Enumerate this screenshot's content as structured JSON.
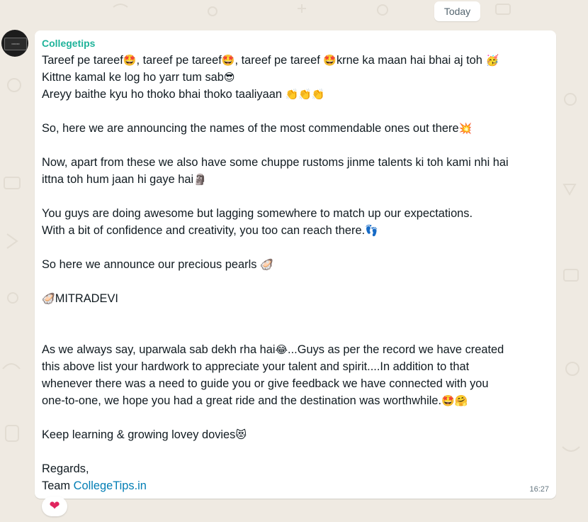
{
  "date_divider": "Today",
  "message": {
    "sender": "Collegetips",
    "time": "16:27",
    "lines": [
      {
        "parts": [
          {
            "t": "Tareef pe tareef"
          },
          {
            "t": "🤩",
            "e": 1
          },
          {
            "t": ", tareef pe tareef"
          },
          {
            "t": "🤩",
            "e": 1
          },
          {
            "t": ", tareef pe tareef "
          },
          {
            "t": "🤩",
            "e": 1
          },
          {
            "t": "krne ka maan hai bhai aj toh "
          },
          {
            "t": "🥳",
            "e": 1
          }
        ]
      },
      {
        "parts": [
          {
            "t": "Kittne kamal ke log ho yarr tum sab"
          },
          {
            "t": "😎",
            "e": 1
          }
        ]
      },
      {
        "parts": [
          {
            "t": "Areyy baithe kyu ho thoko bhai thoko taaliyaan "
          },
          {
            "t": "👏👏👏",
            "e": 1
          }
        ]
      },
      {
        "blank": true
      },
      {
        "parts": [
          {
            "t": "So, here we are announcing the names of the most commendable ones out there"
          },
          {
            "t": "💥",
            "e": 1
          }
        ]
      },
      {
        "blank": true
      },
      {
        "parts": [
          {
            "t": "Now, apart from these we also have some chuppe rustoms jinme talents ki toh kami nhi hai"
          }
        ]
      },
      {
        "parts": [
          {
            "t": "ittna toh hum jaan hi gaye hai"
          },
          {
            "t": "🗿",
            "e": 1
          }
        ]
      },
      {
        "blank": true
      },
      {
        "parts": [
          {
            "t": "You guys are doing awesome but lagging somewhere to match up our expectations."
          }
        ]
      },
      {
        "parts": [
          {
            "t": "With a bit of confidence and creativity, you too can reach there."
          },
          {
            "t": "👣",
            "e": 1
          }
        ]
      },
      {
        "blank": true
      },
      {
        "parts": [
          {
            "t": "So here we announce our precious pearls "
          },
          {
            "t": "🦪",
            "e": 1
          }
        ]
      },
      {
        "blank": true
      },
      {
        "parts": [
          {
            "t": "🦪",
            "e": 1
          },
          {
            "t": "MITRADEVI"
          }
        ]
      },
      {
        "blank": true
      },
      {
        "blank": true
      },
      {
        "parts": [
          {
            "t": "As we always say, uparwala sab dekh rha hai"
          },
          {
            "t": "😂",
            "e": 1
          },
          {
            "t": "...Guys as per the record we have created"
          }
        ]
      },
      {
        "parts": [
          {
            "t": "this above list your hardwork to appreciate your talent and spirit....In addition to that"
          }
        ]
      },
      {
        "parts": [
          {
            "t": "whenever there was a need to guide you or give feedback we have connected with you"
          }
        ]
      },
      {
        "parts": [
          {
            "t": "one-to-one, we hope you had a great ride and the destination was worthwhile."
          },
          {
            "t": "🤩🤗",
            "e": 1
          }
        ]
      },
      {
        "blank": true
      },
      {
        "parts": [
          {
            "t": "Keep learning & growing lovey dovies"
          },
          {
            "t": "😻",
            "e": 1
          }
        ]
      },
      {
        "blank": true
      },
      {
        "parts": [
          {
            "t": "Regards,"
          }
        ]
      },
      {
        "parts": [
          {
            "t": "Team "
          },
          {
            "t": "CollegeTips.in",
            "link": 1
          }
        ]
      }
    ]
  },
  "reaction": "❤",
  "colors": {
    "background": "#efeae2",
    "bubble": "#ffffff",
    "sender": "#1fb39a",
    "link": "#027eb5",
    "timestamp": "#667781"
  }
}
